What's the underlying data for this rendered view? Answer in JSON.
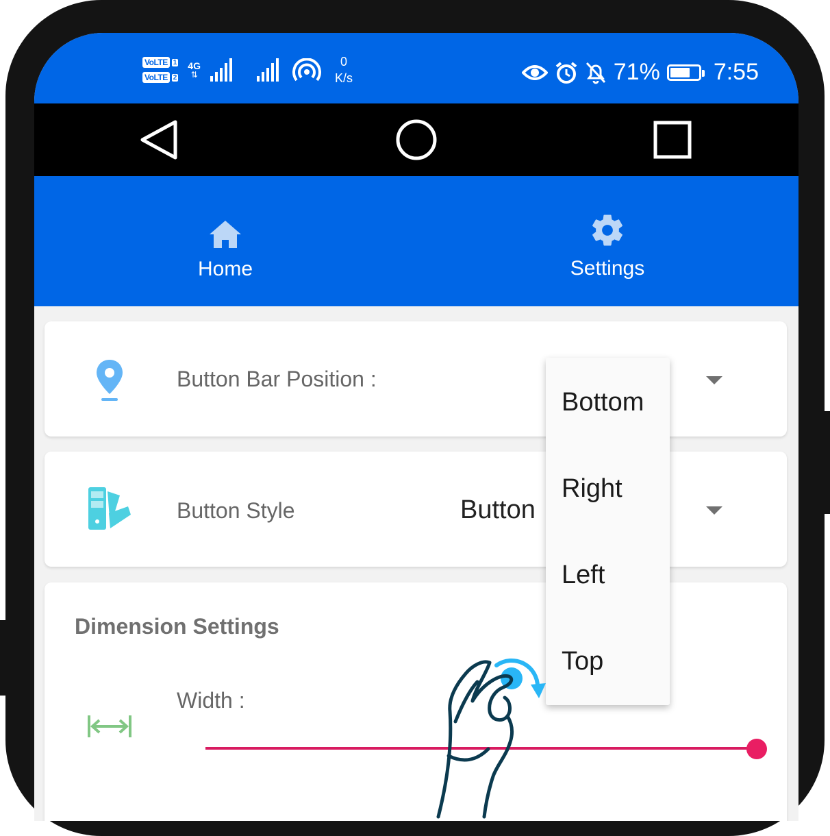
{
  "status_bar": {
    "volte_label": "VoLTE",
    "sim1": "1",
    "sim2": "2",
    "network_type": "4G",
    "speed_value": "0",
    "speed_unit": "K/s",
    "battery_percent": "71%",
    "battery_level": 0.71,
    "time": "7:55"
  },
  "nav_buttons": [
    "back",
    "home",
    "recents"
  ],
  "tabs": [
    {
      "label": "Home",
      "icon": "home-icon"
    },
    {
      "label": "Settings",
      "icon": "gear-icon"
    }
  ],
  "rows": {
    "position": {
      "label": "Button Bar Position :",
      "icon": "map-pin-icon"
    },
    "style": {
      "label": "Button Style",
      "value": "Button",
      "icon": "palette-swatch-icon"
    }
  },
  "dimension": {
    "title": "Dimension Settings",
    "width_label": "Width :",
    "width_icon": "width-arrows-icon",
    "width_value": 1.0
  },
  "dropdown_options": [
    "Bottom",
    "Right",
    "Left",
    "Top"
  ],
  "colors": {
    "primary": "#0066e6",
    "pin": "#64b5f6",
    "palette": "#4dd0e1",
    "width_icon": "#81c784",
    "slider": "#e91e63",
    "gesture_hand": "#0b3a4f",
    "gesture_arrow": "#29b6f6"
  }
}
